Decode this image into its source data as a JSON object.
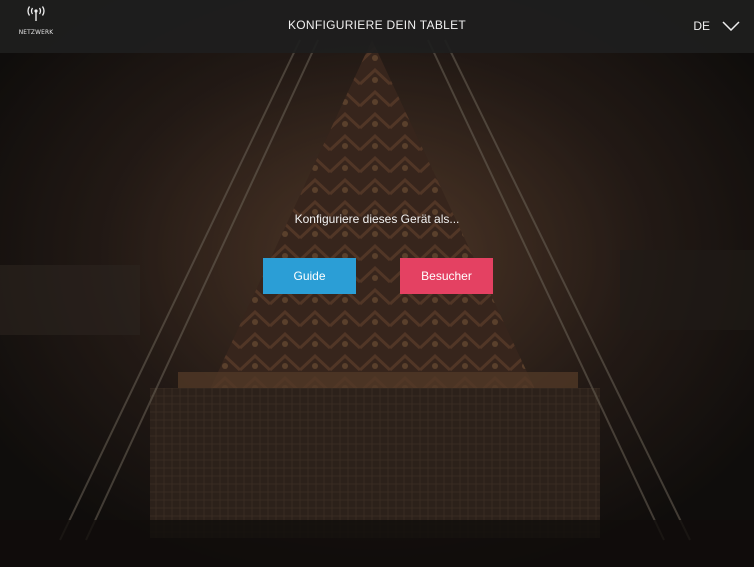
{
  "header": {
    "network_label": "NETZWERK",
    "title": "KONFIGURIERE DEIN TABLET",
    "language": "DE",
    "network_icon": "wifi-antenna-icon",
    "language_icon": "chevron-down-icon"
  },
  "main": {
    "prompt": "Konfiguriere dieses Gerät als...",
    "guide_button": "Guide",
    "visitor_button": "Besucher"
  },
  "colors": {
    "guide": "#2b9ed6",
    "visitor": "#e44162"
  }
}
